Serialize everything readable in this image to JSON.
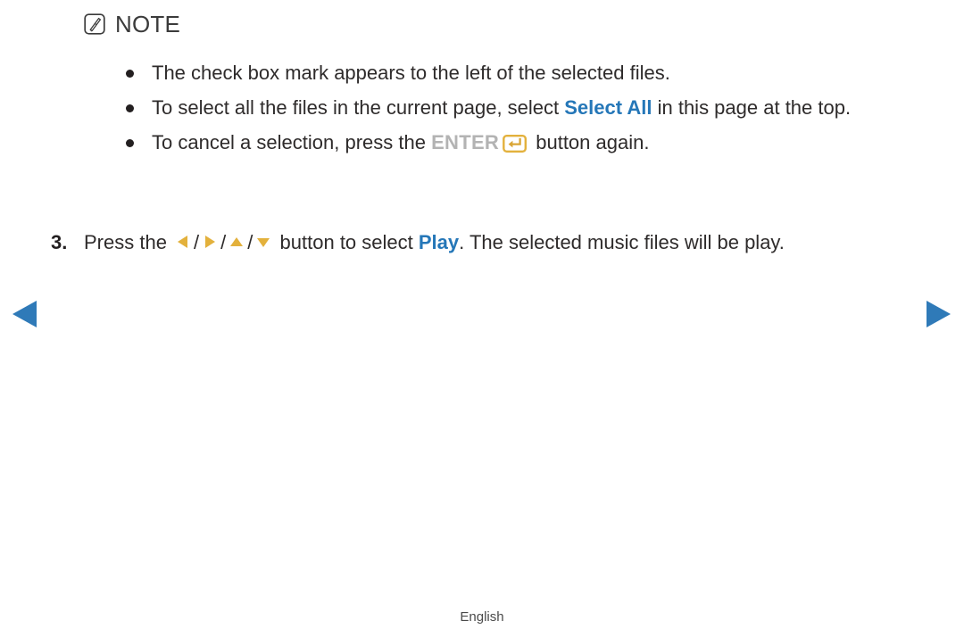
{
  "note": {
    "icon": "note-pen-icon",
    "label": "NOTE"
  },
  "bullets": [
    {
      "text": "The check box mark appears to the left of the selected files."
    },
    {
      "pre": "To select all the files in the current page, select ",
      "emphasis": "Select All",
      "post": " in this page at the top."
    },
    {
      "pre": "To cancel a selection, press the ",
      "key": "ENTER",
      "key_icon": "enter-key-icon",
      "post": " button again."
    }
  ],
  "step": {
    "number": "3.",
    "pre": "Press the ",
    "arrow_icons": [
      "arrow-left-icon",
      "arrow-right-icon",
      "arrow-up-icon",
      "arrow-down-icon"
    ],
    "separator": "/",
    "mid": " button to select ",
    "emphasis": "Play",
    "post": ". The selected music files will be play."
  },
  "nav": {
    "prev_icon": "arrow-left-nav-icon",
    "next_icon": "arrow-right-nav-icon"
  },
  "footer": {
    "language": "English"
  },
  "colors": {
    "accent_blue": "#2577b8",
    "accent_gold": "#e3b13c",
    "body_text": "#2e2b2b",
    "muted_gray": "#b3b3b3"
  }
}
